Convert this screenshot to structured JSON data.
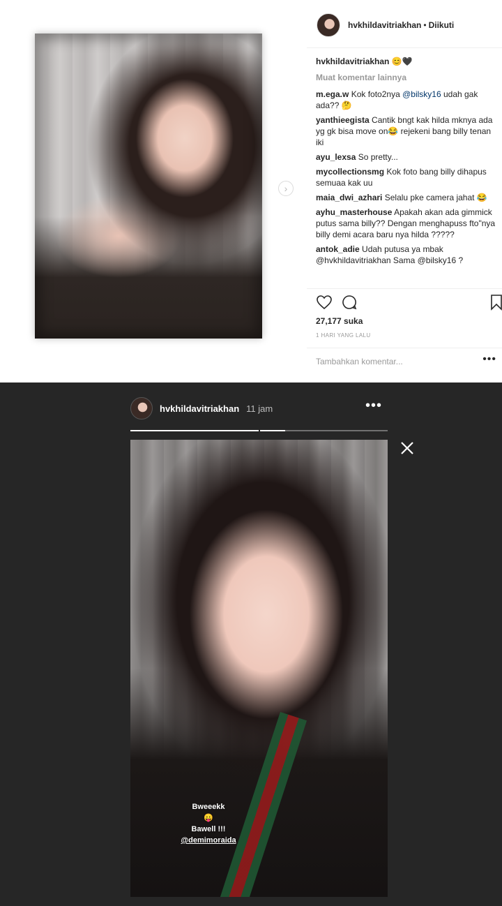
{
  "post": {
    "username": "hvkhildavitriakhan",
    "separator": "•",
    "follow_status": "Diikuti",
    "caption": {
      "username": "hvkhildavitriakhan",
      "text": "😊🖤"
    },
    "load_more": "Muat komentar lainnya",
    "comments": [
      {
        "username": "m.ega.w",
        "parts": [
          "Kok foto2nya ",
          "@bilsky16",
          " udah gak ada?? 🤔"
        ]
      },
      {
        "username": "yanthieegista",
        "parts": [
          "Cantik bngt kak hilda mknya ada yg gk bisa move on😂 rejekeni bang billy tenan iki"
        ]
      },
      {
        "username": "ayu_lexsa",
        "parts": [
          "So pretty..."
        ]
      },
      {
        "username": "mycollectionsmg",
        "parts": [
          "Kok foto bang billy dihapus semuaa kak uu"
        ]
      },
      {
        "username": "maia_dwi_azhari",
        "parts": [
          "Selalu pke camera jahat 😂"
        ]
      },
      {
        "username": "ayhu_masterhouse",
        "parts": [
          "Apakah akan ada gimmick putus sama billy?? Dengan menghapuss fto\"nya billy demi acara baru nya hilda ?????"
        ]
      },
      {
        "username": "antok_adie",
        "parts": [
          "Udah putusa ya mbak @hvkhildavitriakhan Sama @bilsky16 ?"
        ]
      }
    ],
    "likes": "27,177 suka",
    "posted": "1 HARI YANG LALU",
    "add_comment_placeholder": "Tambahkan komentar...",
    "more_label": "•••",
    "next_arrow": "›",
    "icons": [
      "heart-icon",
      "comment-icon",
      "bookmark-icon"
    ]
  },
  "story": {
    "username": "hvkhildavitriakhan",
    "time": "11 jam",
    "more_label": "•••",
    "progress": [
      1.0,
      0.2
    ],
    "text_line1": "Bweeekk",
    "text_emoji": "😛",
    "text_line2": "Bawell !!!",
    "text_mention": "@demimoraida",
    "background_color": "#262626"
  }
}
